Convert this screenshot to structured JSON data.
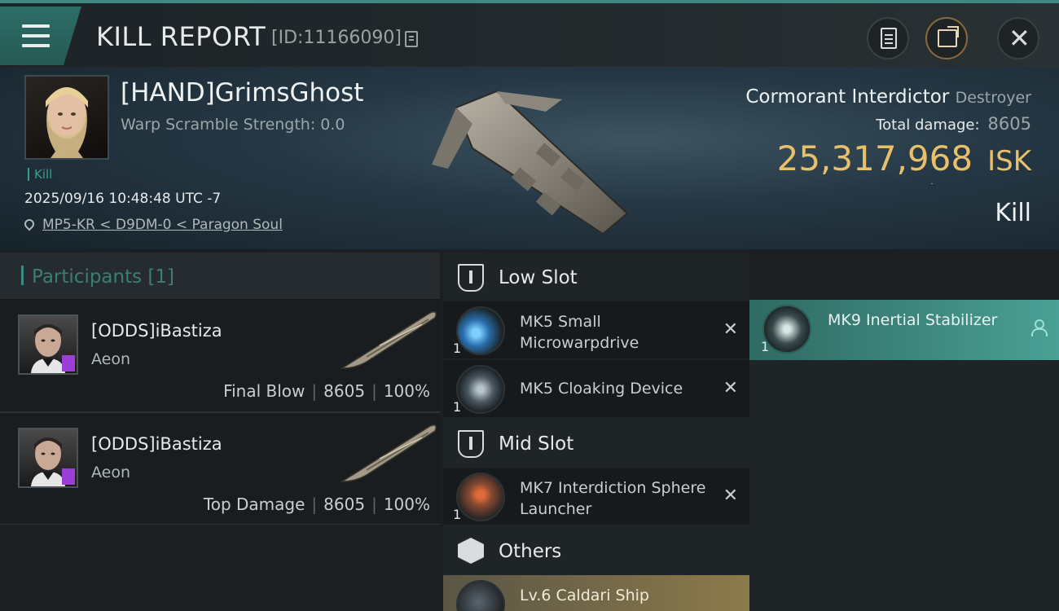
{
  "header": {
    "title": "KILL REPORT",
    "report_id": "[ID:11166090]"
  },
  "victim": {
    "name": "[HAND]GrimsGhost",
    "warp_scramble": "Warp Scramble Strength: 0.0",
    "tag": "Kill",
    "timestamp": "2025/09/16 10:48:48 UTC -7",
    "location": "MP5-KR < D9DM-0 < Paragon Soul",
    "ship_name": "Cormorant Interdictor",
    "ship_class": "Destroyer",
    "total_damage_label": "Total damage:",
    "total_damage": "8605",
    "isk_value": "25,317,968",
    "isk_unit": "ISK",
    "result": "Kill"
  },
  "participants": {
    "label": "Participants",
    "count": "[1]",
    "rows": [
      {
        "name": "[ODDS]iBastiza",
        "ship": "Aeon",
        "role": "Final Blow",
        "damage": "8605",
        "percent": "100%"
      },
      {
        "name": "[ODDS]iBastiza",
        "ship": "Aeon",
        "role": "Top Damage",
        "damage": "8605",
        "percent": "100%"
      }
    ]
  },
  "slots": {
    "low": {
      "label": "Low Slot",
      "items": [
        {
          "name": "MK5 Small Microwarpdrive",
          "qty": "1"
        },
        {
          "name": "MK5 Cloaking Device",
          "qty": "1"
        }
      ]
    },
    "mid": {
      "label": "Mid Slot",
      "items": [
        {
          "name": "MK7 Interdiction Sphere Launcher",
          "qty": "1"
        }
      ]
    },
    "others": {
      "label": "Others",
      "items": [
        {
          "name": "Lv.6 Caldari Ship"
        }
      ]
    },
    "dropped": {
      "items": [
        {
          "name": "MK9 Inertial Stabilizer",
          "qty": "1"
        }
      ]
    }
  },
  "colors": {
    "accent": "#3e8a82",
    "isk": "#e8bf6a",
    "dropped_bg": "#3f8a80",
    "implant_badge": "#9b3fd6"
  }
}
